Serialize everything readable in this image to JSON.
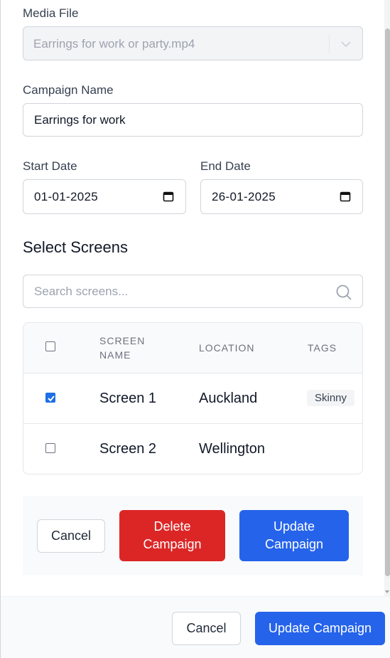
{
  "form": {
    "media_label": "Media File",
    "media_value": "Earrings for work or party.mp4",
    "campaign_label": "Campaign Name",
    "campaign_value": "Earrings for work",
    "start_label": "Start Date",
    "start_value": "01-01-2025",
    "end_label": "End Date",
    "end_value": "26-01-2025"
  },
  "screens": {
    "title": "Select Screens",
    "search_placeholder": "Search screens...",
    "columns": [
      "SCREEN\nNAME",
      "LOCATION",
      "TAGS"
    ],
    "rows": [
      {
        "name": "Screen 1",
        "location": "Auckland",
        "tag": "Skinny",
        "checked": true
      },
      {
        "name": "Screen 2",
        "location": "Wellington",
        "tag": "",
        "checked": false
      }
    ]
  },
  "inline_actions": {
    "cancel": "Cancel",
    "delete": "Delete Campaign",
    "update": "Update Campaign"
  },
  "footer": {
    "cancel": "Cancel",
    "update": "Update Campaign"
  },
  "colors": {
    "primary": "#2563eb",
    "danger": "#dc2626"
  }
}
